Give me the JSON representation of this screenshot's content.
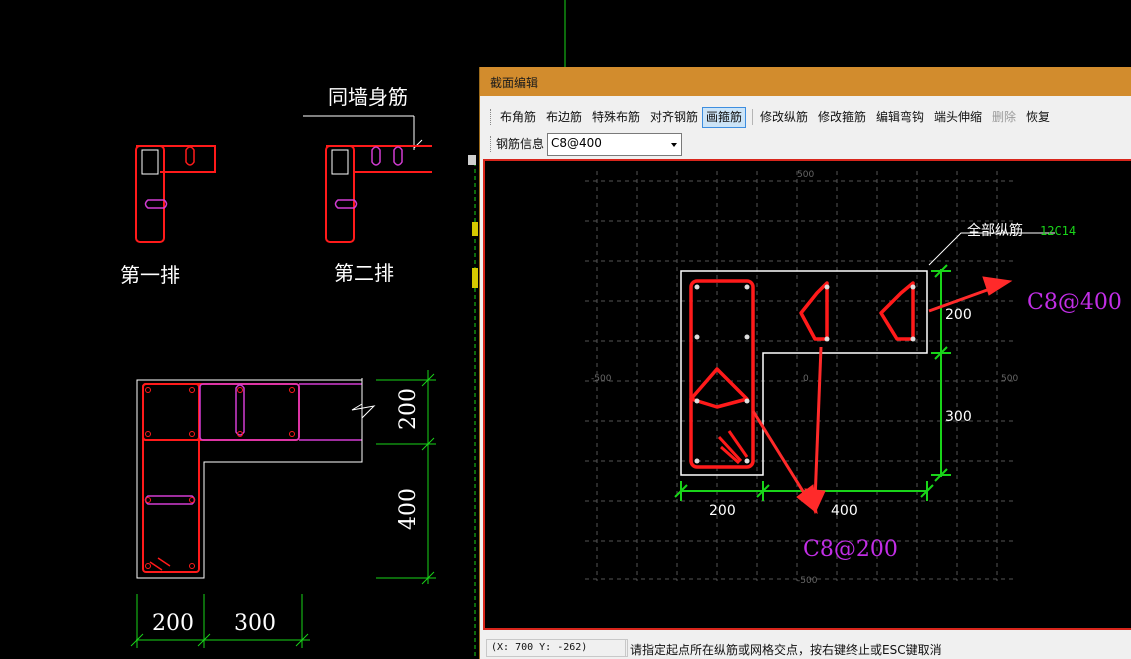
{
  "background_drawing": {
    "leader_label": "同墙身筋",
    "row1_label": "第一排",
    "row2_label": "第二排",
    "dim_h1": "200",
    "dim_h2": "300",
    "dim_v1": "200",
    "dim_v2": "400"
  },
  "dialog": {
    "title": "截面编辑",
    "toolbar1": [
      {
        "label": "布角筋"
      },
      {
        "label": "布边筋"
      },
      {
        "label": "特殊布筋"
      },
      {
        "label": "对齐钢筋"
      },
      {
        "label": "画箍筋",
        "active": true
      },
      {
        "label": "修改纵筋"
      },
      {
        "label": "修改箍筋"
      },
      {
        "label": "编辑弯钩"
      },
      {
        "label": "端头伸缩"
      },
      {
        "label": "删除",
        "disabled": true
      },
      {
        "label": "恢复"
      }
    ],
    "rebar_info_label": "钢筋信息",
    "rebar_info_value": "C8@400"
  },
  "section_canvas": {
    "axis_labels": {
      "top": "500",
      "left": "-500",
      "center": "0",
      "right": "500",
      "bottom": "-500"
    },
    "all_long_rebar_label": "全部纵筋",
    "all_long_rebar_value": "12C14",
    "annotation_1": "C8@400",
    "annotation_2": "C8@200",
    "dim_horizontal": [
      "200",
      "400"
    ],
    "dim_vertical": [
      "200",
      "300"
    ]
  },
  "status": {
    "coords": "(X: 700 Y: -262)",
    "prompt": "请指定起点所在纵筋或网格交点，按右键终止或ESC键取消"
  },
  "colors": {
    "rebar_red": "#ff1a1a",
    "stirrup_magenta": "#d23cd2",
    "dimension_green": "#19d419",
    "annotation_magenta": "#c22ee6",
    "titlebar_orange": "#d28c2d"
  }
}
